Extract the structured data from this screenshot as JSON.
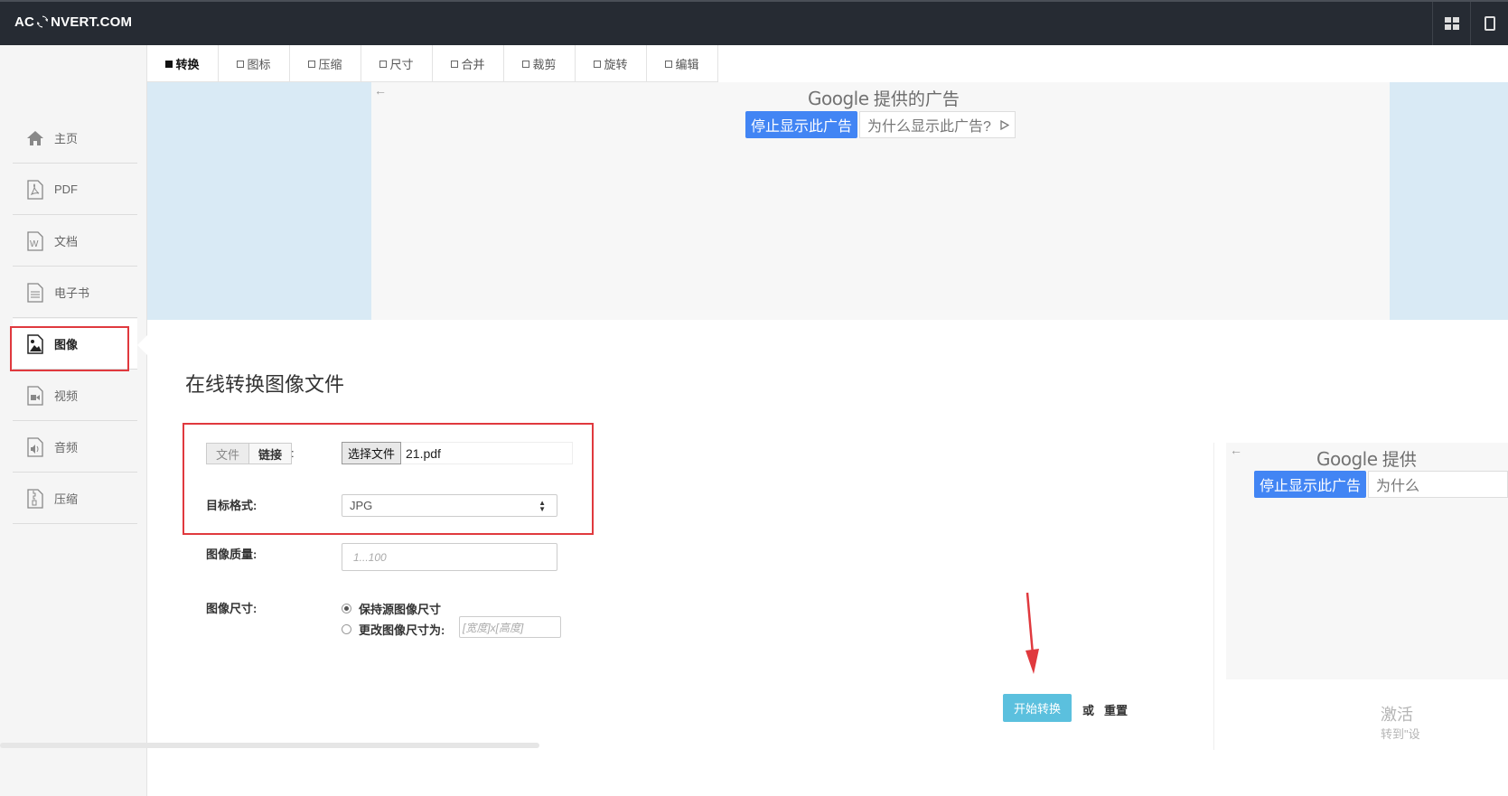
{
  "header": {
    "logo_pre": "AC",
    "logo_post": "NVERT.COM",
    "icons": [
      "grid-icon",
      "tablet-icon"
    ]
  },
  "sidebar": {
    "items": [
      {
        "label": "主页",
        "icon": "home-icon"
      },
      {
        "label": "PDF",
        "icon": "pdf-icon"
      },
      {
        "label": "文档",
        "icon": "document-icon"
      },
      {
        "label": "电子书",
        "icon": "ebook-icon"
      },
      {
        "label": "图像",
        "icon": "image-icon",
        "active": true
      },
      {
        "label": "视频",
        "icon": "video-icon"
      },
      {
        "label": "音频",
        "icon": "audio-icon"
      },
      {
        "label": "压缩",
        "icon": "archive-icon"
      }
    ]
  },
  "tabs": [
    {
      "label": "转换",
      "active": true
    },
    {
      "label": "图标"
    },
    {
      "label": "压缩"
    },
    {
      "label": "尺寸"
    },
    {
      "label": "合并"
    },
    {
      "label": "裁剪"
    },
    {
      "label": "旋转"
    },
    {
      "label": "编辑"
    }
  ],
  "ad": {
    "back": "←",
    "google": "Google",
    "provided": "提供的广告",
    "provided_short": "提供",
    "stop": "停止显示此广告",
    "why": "为什么显示此广告?",
    "why_short": "为什么"
  },
  "form": {
    "title": "在线转换图像文件",
    "source_file": "文件",
    "source_link": "链接",
    "colon": ":",
    "choose_file": "选择文件",
    "file_name": "21.pdf",
    "target_label": "目标格式:",
    "target_value": "JPG",
    "quality_label": "图像质量:",
    "quality_placeholder": "1...100",
    "size_label": "图像尺寸:",
    "size_keep": "保持源图像尺寸",
    "size_change": "更改图像尺寸为:",
    "size_placeholder": "[宽度]x[高度]",
    "start": "开始转换",
    "or": "或",
    "reset": "重置"
  },
  "watermark": {
    "line1": "激活",
    "line2": "转到\"设"
  },
  "colors": {
    "topbar": "#262b33",
    "annotation_red": "#e0393e",
    "start_button": "#5bc0de",
    "google_blue": "#4285f4",
    "ad_blue": "#d9eaf5"
  }
}
